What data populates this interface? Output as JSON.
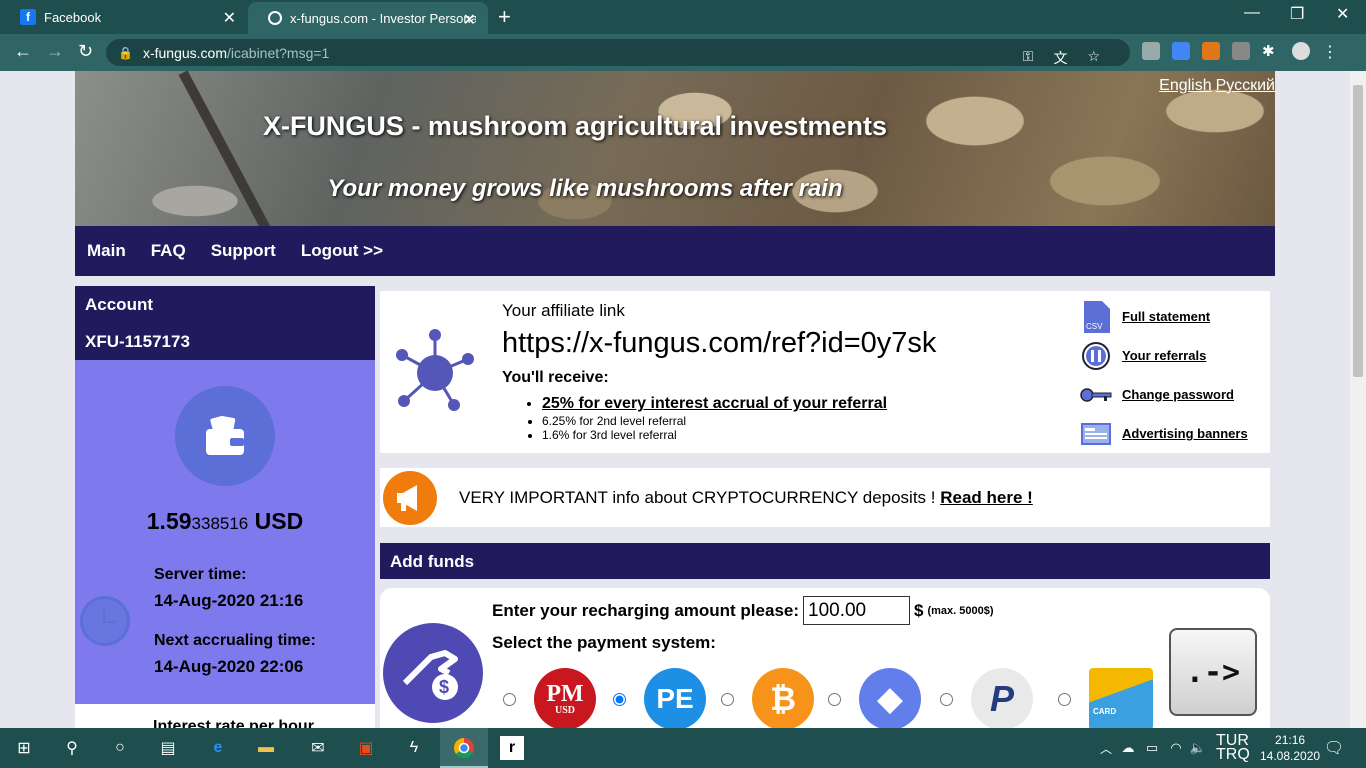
{
  "browser": {
    "tabs": [
      {
        "title": "Facebook"
      },
      {
        "title": "x-fungus.com - Investor Personal"
      }
    ],
    "url_host": "x-fungus.com",
    "url_path": "/icabinet?msg=1"
  },
  "banner": {
    "title": "X-FUNGUS - mushroom agricultural investments",
    "subtitle": "Your money grows like mushrooms after rain",
    "lang_en": "English",
    "lang_ru": "Русский"
  },
  "nav": {
    "main": "Main",
    "faq": "FAQ",
    "support": "Support",
    "logout": "Logout >>"
  },
  "sidebar": {
    "account_label": "Account",
    "account_id": "XFU-1157173",
    "balance_main": "1.59",
    "balance_small": "338516",
    "balance_currency": "USD",
    "server_time_label": "Server time:",
    "server_time": "14-Aug-2020 21:16",
    "next_accrual_label": "Next accrualing time:",
    "next_accrual": "14-Aug-2020 22:06",
    "interest_label": "Interest rate per hour"
  },
  "affiliate": {
    "title": "Your affiliate link",
    "link": "https://x-fungus.com/ref?id=0y7sk",
    "receive_label": "You'll receive:",
    "levels": [
      "25% for every interest accrual of your referral",
      "6.25% for 2nd level referral",
      "1.6% for 3rd level referral"
    ],
    "links": {
      "full_statement": "Full statement",
      "referrals": "Your referrals",
      "change_password": "Change password",
      "banners": "Advertising banners"
    },
    "csv_label": "CSV"
  },
  "info": {
    "text": "VERY IMPORTANT info about CRYPTOCURRENCY deposits ! ",
    "link": "Read here !"
  },
  "add_funds": {
    "title": "Add funds",
    "amount_label": "Enter your recharging amount please:",
    "amount_value": "100.00",
    "currency_symbol": "$",
    "max_note": "(max. 5000$)",
    "select_label": "Select the payment system:",
    "systems": [
      {
        "name": "perfect-money",
        "label": "PM",
        "sub": "USD",
        "color": "#c8171e",
        "checked": false
      },
      {
        "name": "payeer",
        "label": "PE",
        "color": "#1d8fe4",
        "checked": true
      },
      {
        "name": "bitcoin",
        "label": "₿",
        "color": "#f7931a",
        "checked": false
      },
      {
        "name": "ethereum",
        "label": "◆",
        "color": "#627eea",
        "checked": false
      },
      {
        "name": "paypal",
        "label": "P",
        "color": "#e9e9e9",
        "checked": false
      },
      {
        "name": "card",
        "label": "CARD",
        "color": "#3aa0e0",
        "checked": false
      }
    ],
    "submit_label": ".->"
  },
  "taskbar": {
    "lang_top": "TUR",
    "lang_bottom": "TRQ",
    "time": "21:16",
    "date": "14.08.2020"
  },
  "colors": {
    "nav_dark": "#211a5c",
    "sidebar": "#7f79ee",
    "chrome": "#1e4e4e"
  }
}
